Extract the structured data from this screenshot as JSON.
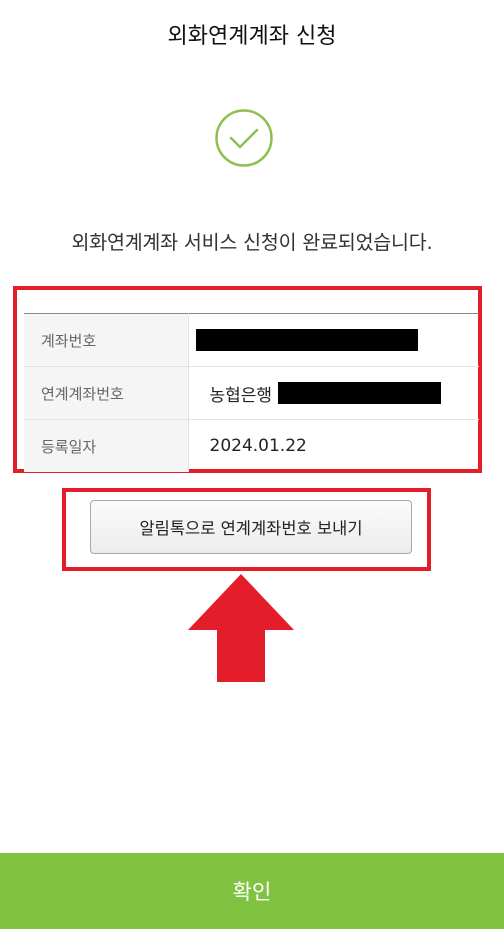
{
  "header": {
    "title": "외화연계계좌 신청"
  },
  "status": {
    "icon": "check-circle-icon",
    "accent_color": "#8cc152",
    "message": "외화연계계좌 서비스 신청이 완료되었습니다."
  },
  "info": {
    "rows": [
      {
        "label": "계좌번호",
        "value": ""
      },
      {
        "label": "연계계좌번호",
        "value": "농협은행"
      },
      {
        "label": "등록일자",
        "value": "2024.01.22"
      }
    ]
  },
  "actions": {
    "kakao_send_label": "알림톡으로 연계계좌번호 보내기",
    "confirm_label": "확인",
    "confirm_color": "#80c340"
  },
  "annotations": {
    "highlight_color": "#e31e2a",
    "arrow_icon": "arrow-up-icon"
  }
}
